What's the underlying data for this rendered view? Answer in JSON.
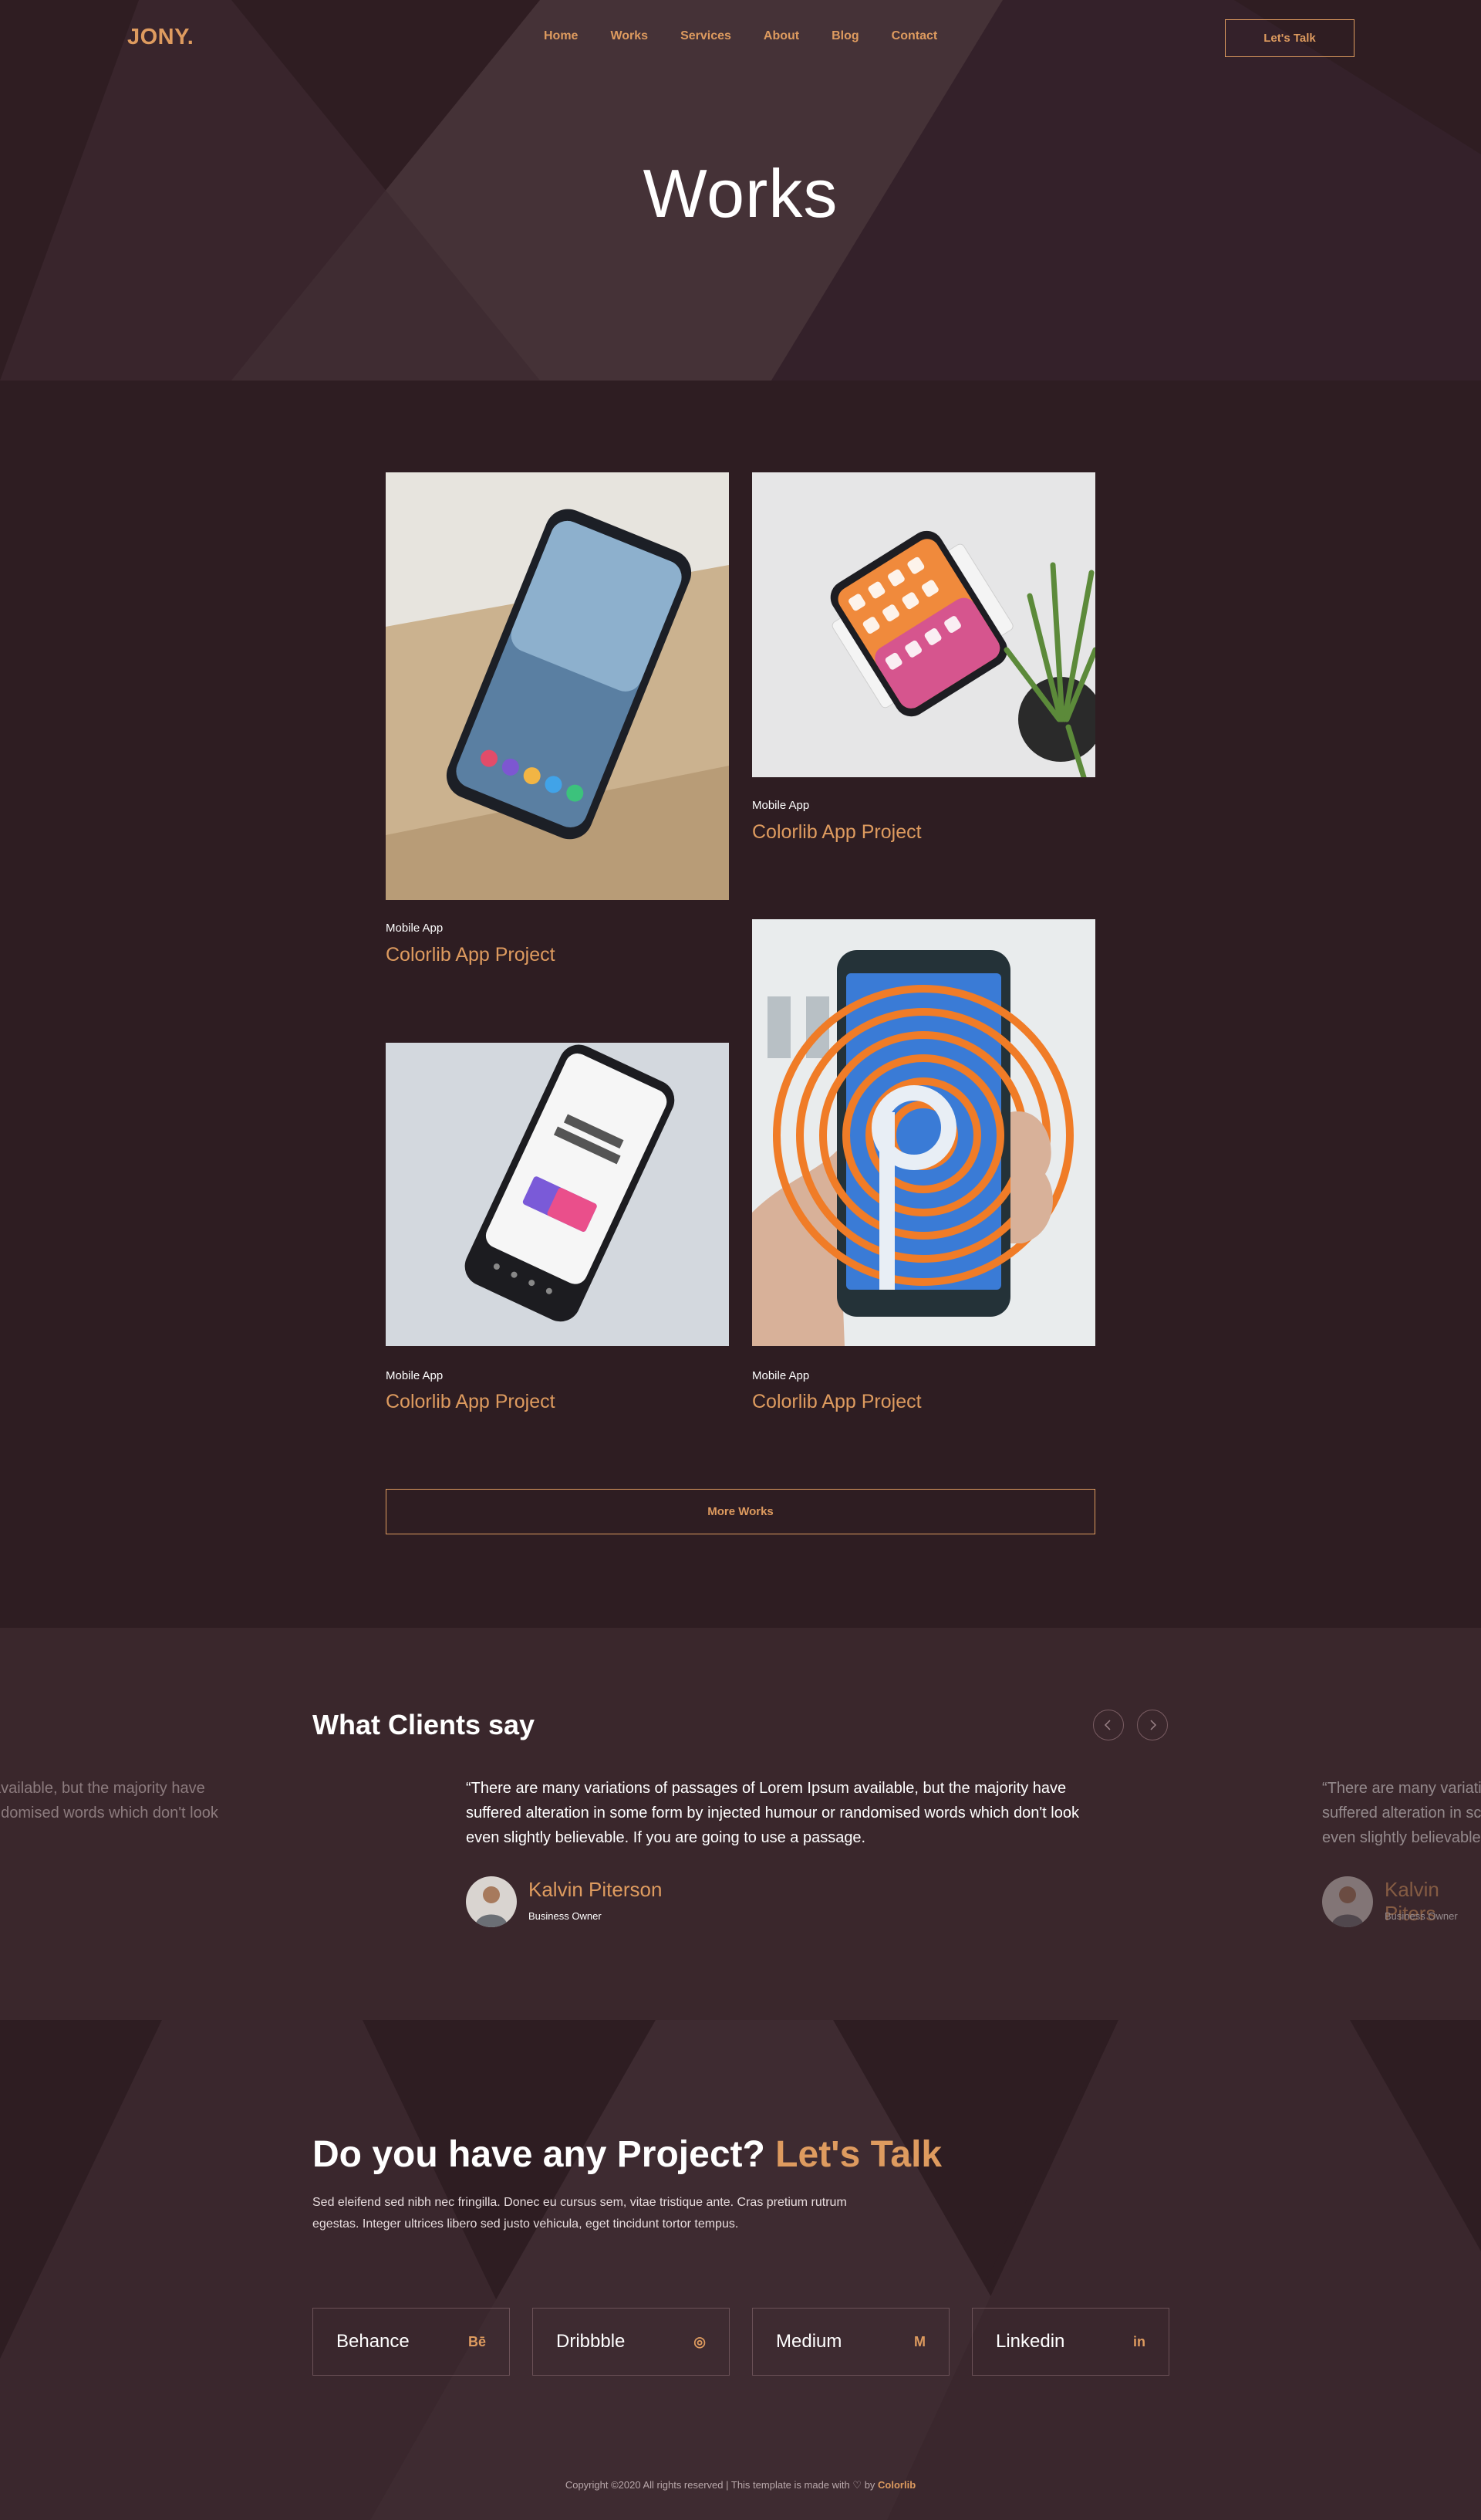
{
  "brand": {
    "logo": "JONY."
  },
  "nav": {
    "items": [
      {
        "label": "Home"
      },
      {
        "label": "Works"
      },
      {
        "label": "Services"
      },
      {
        "label": "About"
      },
      {
        "label": "Blog"
      },
      {
        "label": "Contact"
      }
    ],
    "cta_label": "Let's Talk"
  },
  "hero": {
    "title": "Works"
  },
  "works": {
    "items": [
      {
        "category": "Mobile App",
        "title": "Colorlib App Project"
      },
      {
        "category": "Mobile App",
        "title": "Colorlib App Project"
      },
      {
        "category": "Mobile App",
        "title": "Colorlib App Project"
      },
      {
        "category": "Mobile App",
        "title": "Colorlib App Project"
      }
    ],
    "more_label": "More Works"
  },
  "testimonials": {
    "heading": "What Clients say",
    "prev_icon": "chevron-left-icon",
    "next_icon": "chevron-right-icon",
    "left_partial_quote": "available, but the majority have\nndomised words which don't look\n.",
    "items": [
      {
        "quote": "“There are many variations of passages of Lorem Ipsum available, but the majority have suffered alteration in some form by injected humour or randomised words which don't look even slightly believable. If you are going to use a passage.",
        "name": "Kalvin Piterson",
        "role": "Business Owner"
      },
      {
        "quote": "“There are many variati\nsuffered alteration in sc\neven slightly believable.",
        "name": "Kalvin Piters",
        "role": "Business Owner"
      }
    ]
  },
  "contact": {
    "heading_main": "Do you have any Project?",
    "heading_accent": "Let's Talk",
    "text": "Sed eleifend sed nibh nec fringilla. Donec eu cursus sem, vitae tristique ante. Cras pretium rutrum egestas. Integer ultrices libero sed justo vehicula, eget tincidunt tortor tempus.",
    "socials": [
      {
        "label": "Behance",
        "icon": "Bē",
        "icon_name": "behance-icon"
      },
      {
        "label": "Dribbble",
        "icon": "◎",
        "icon_name": "dribbble-icon"
      },
      {
        "label": "Medium",
        "icon": "M",
        "icon_name": "medium-icon"
      },
      {
        "label": "Linkedin",
        "icon": "in",
        "icon_name": "linkedin-icon"
      }
    ]
  },
  "footer": {
    "copyright_prefix": "Copyright ©2020 All rights reserved | This template is made with",
    "copyright_by": "by",
    "copyright_brand": "Colorlib"
  },
  "colors": {
    "accent": "#de9b5f",
    "background": "#2e1d22",
    "hero_bg": "#382329",
    "testimonial_bg": "#3a272c"
  }
}
